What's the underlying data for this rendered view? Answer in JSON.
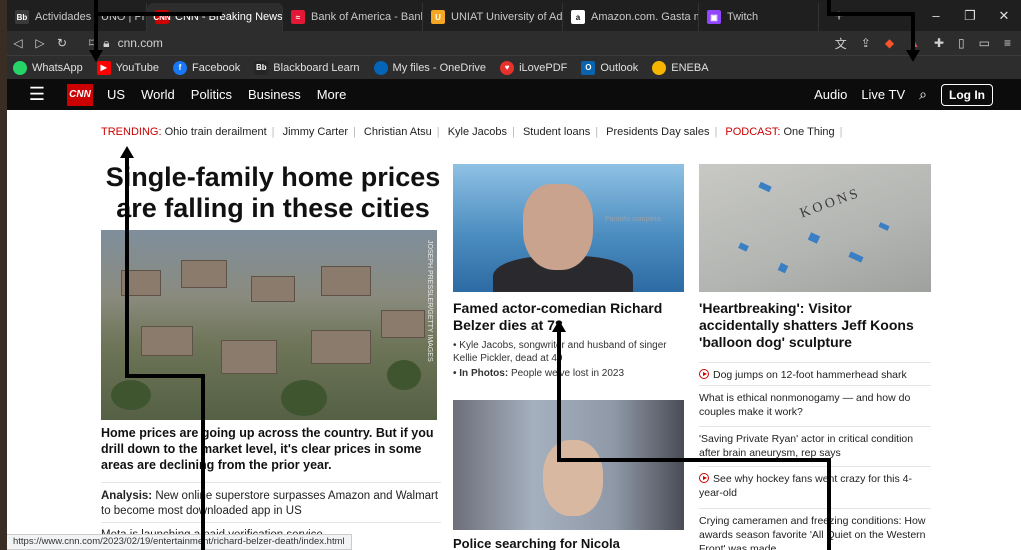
{
  "tabs": [
    {
      "label": "Actividades - UNO | Progra",
      "icon": "blackboard-icon",
      "color": "#3a3a3a"
    },
    {
      "label": "CNN - Breaking News,",
      "icon": "cnn-icon",
      "color": "#cc0000",
      "active": true
    },
    {
      "label": "Bank of America - Banking",
      "icon": "bofa-icon",
      "color": "#e31837"
    },
    {
      "label": "UNIAT University of Advanc",
      "icon": "uniat-icon",
      "color": "#f5a623"
    },
    {
      "label": "Amazon.com. Gasta menos",
      "icon": "amazon-icon",
      "color": "#ffffff"
    },
    {
      "label": "Twitch",
      "icon": "twitch-icon",
      "color": "#9146ff"
    }
  ],
  "address": {
    "url": "cnn.com"
  },
  "bookmarks": [
    {
      "label": "WhatsApp",
      "icon": "whatsapp-icon",
      "color": "#25d366"
    },
    {
      "label": "YouTube",
      "icon": "youtube-icon",
      "color": "#ff0000"
    },
    {
      "label": "Facebook",
      "icon": "facebook-icon",
      "color": "#1877f2"
    },
    {
      "label": "Blackboard Learn",
      "icon": "blackboard-icon",
      "color": "#262626"
    },
    {
      "label": "My files - OneDrive",
      "icon": "onedrive-icon",
      "color": "#0364b8"
    },
    {
      "label": "iLovePDF",
      "icon": "ilovepdf-icon",
      "color": "#e5322d"
    },
    {
      "label": "Outlook",
      "icon": "outlook-icon",
      "color": "#0a64ad"
    },
    {
      "label": "ENEBA",
      "icon": "eneba-icon",
      "color": "#f6b500"
    }
  ],
  "cnn_nav": {
    "logo": "CNN",
    "links": [
      "US",
      "World",
      "Politics",
      "Business",
      "More"
    ],
    "audio": "Audio",
    "live": "Live TV",
    "login": "Log In"
  },
  "trending": {
    "label": "TRENDING:",
    "items": [
      "Ohio train derailment",
      "Jimmy Carter",
      "Christian Atsu",
      "Kyle Jacobs",
      "Student loans",
      "Presidents Day sales"
    ],
    "podcast_label": "PODCAST:",
    "podcast": "One Thing"
  },
  "lead": {
    "title": "Single-family home prices are falling in these cities",
    "photo_credit": "JOSEPH PRESSLER/GETTY IMAGES",
    "description": "Home prices are going up across the country. But if you drill down to the market level, it's clear prices in some areas are declining from the prior year.",
    "analysis_label": "Analysis:",
    "analysis": "New online superstore surpasses Amazon and Walmart to become most downloaded app in US",
    "meta": "Meta is launching a paid verification service"
  },
  "middle": {
    "title": "Famed actor-comedian Richard Belzer dies at 78",
    "bullet1": "• Kyle Jacobs, songwriter and husband of singer Kellie Pickler, dead at 49",
    "bullet2_label": "• In Photos:",
    "bullet2": "People we've lost in 2023",
    "overlay": "Pantalla completa",
    "title2": "Police searching for Nicola"
  },
  "right": {
    "title": "'Heartbreaking': Visitor accidentally shatters Jeff Koons 'balloon dog' sculpture",
    "image_text": "KOONS",
    "links": [
      {
        "text": "Dog jumps on 12-foot hammerhead shark",
        "video": true
      },
      {
        "text": "What is ethical nonmonogamy — and how do couples make it work?",
        "video": false
      },
      {
        "text": "'Saving Private Ryan' actor in critical condition after brain aneurysm, rep says",
        "video": false
      },
      {
        "text": "See why hockey fans went crazy for this 4-year-old",
        "video": true
      },
      {
        "text": "Crying cameramen and freezing conditions: How awards season favorite 'All Quiet on the Western Front' was made",
        "video": false
      }
    ]
  },
  "status_url": "https://www.cnn.com/2023/02/19/entertainment/richard-belzer-death/index.html"
}
